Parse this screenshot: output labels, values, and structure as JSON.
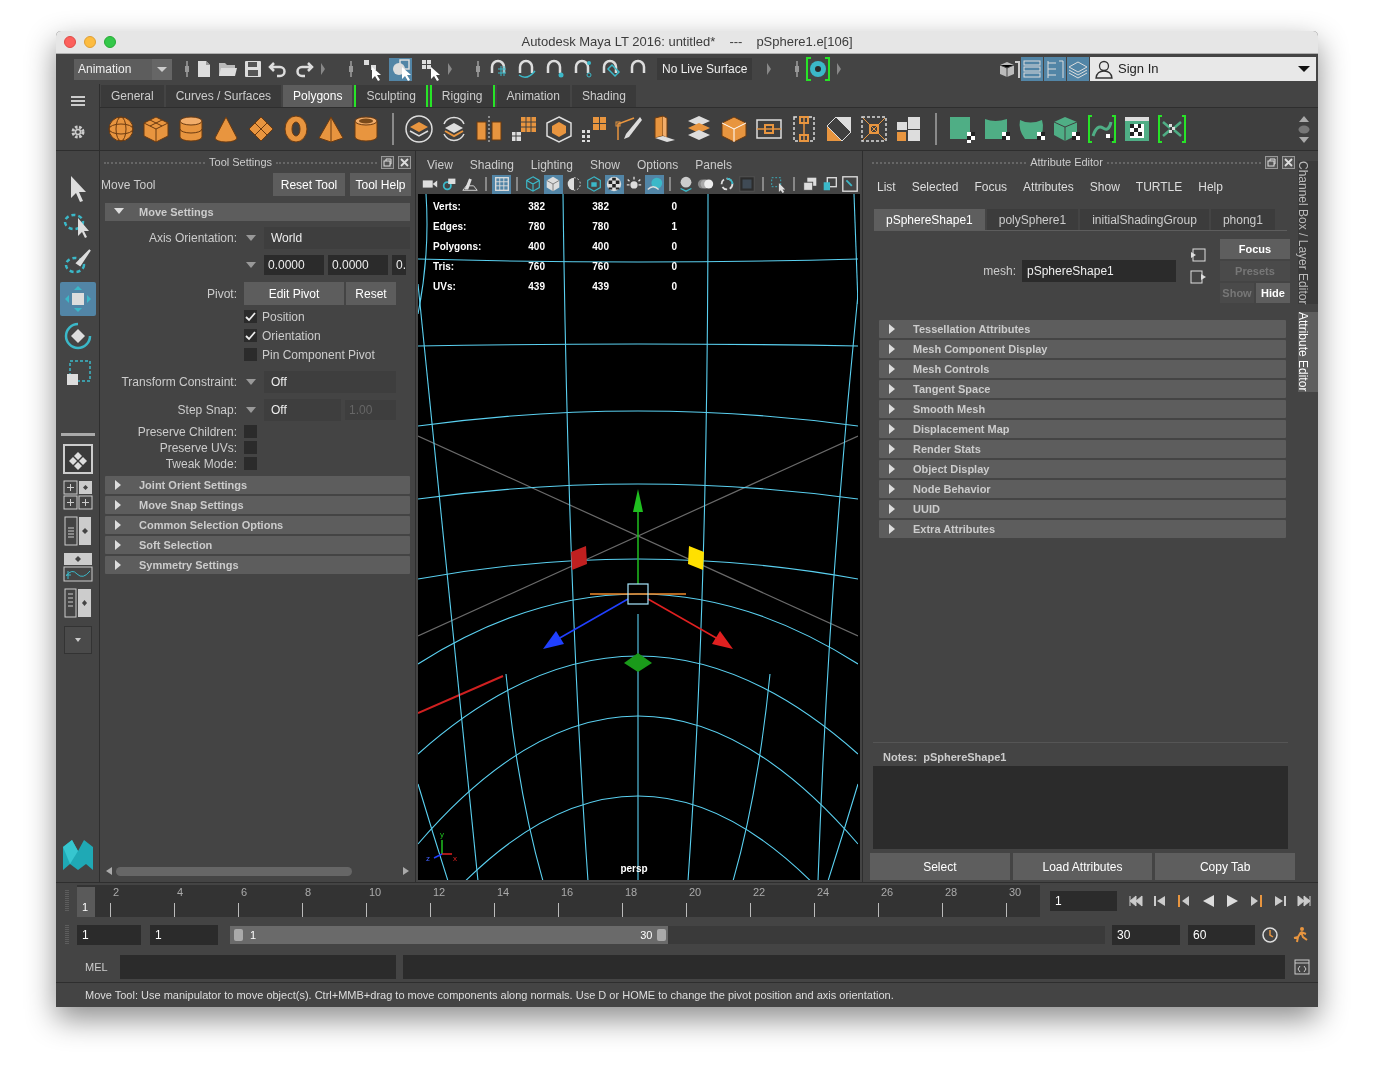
{
  "window": {
    "title": "Autodesk Maya LT 2016: untitled*",
    "separator": "---",
    "selection": "pSphere1.e[106]"
  },
  "status_line": {
    "menu_set": "Animation",
    "select_modes": [
      {
        "on": false
      },
      {
        "on": true
      },
      {
        "on": false
      }
    ],
    "live_surface": "No Live Surface",
    "panel_toggles": [
      {
        "on": true
      },
      {
        "on": true
      },
      {
        "on": true
      }
    ],
    "sign_in": "Sign In"
  },
  "shelf_tabs": [
    {
      "label": "General",
      "selected": false,
      "bracketed": false
    },
    {
      "label": "Curves / Surfaces",
      "selected": false,
      "bracketed": false
    },
    {
      "label": "Polygons",
      "selected": true,
      "bracketed": false
    },
    {
      "label": "Sculpting",
      "selected": false,
      "bracketed": true
    },
    {
      "label": "Rigging",
      "selected": false,
      "bracketed": true
    },
    {
      "label": "Animation",
      "selected": false,
      "bracketed": false
    },
    {
      "label": "Shading",
      "selected": false,
      "bracketed": false
    }
  ],
  "toolbox": {
    "tools": [
      {
        "selected": false
      },
      {
        "selected": false
      },
      {
        "selected": false
      },
      {
        "selected": true
      },
      {
        "selected": false
      },
      {
        "selected": false
      }
    ]
  },
  "tool_settings": {
    "title": "Tool Settings",
    "tool": "Move Tool",
    "buttons": [
      "Reset Tool",
      "Tool Help"
    ],
    "move_settings": {
      "label": "Move Settings",
      "expanded": true,
      "axis_orientation": {
        "label": "Axis Orientation:",
        "value": "World"
      },
      "custom_axis": [
        "0.0000",
        "0.0000",
        "0."
      ],
      "pivot": {
        "label": "Pivot:",
        "buttons": [
          "Edit Pivot",
          "Reset"
        ]
      },
      "pivot_options": [
        {
          "label": "Position",
          "checked": true
        },
        {
          "label": "Orientation",
          "checked": true
        },
        {
          "label": "Pin Component Pivot",
          "checked": false
        }
      ],
      "transform_constraint": {
        "label": "Transform Constraint:",
        "value": "Off"
      },
      "step_snap": {
        "label": "Step Snap:",
        "value": "Off",
        "amount": "1.00"
      },
      "toggles": [
        {
          "label": "Preserve Children:",
          "checked": false
        },
        {
          "label": "Preserve UVs:",
          "checked": false
        },
        {
          "label": "Tweak Mode:",
          "checked": false
        }
      ]
    },
    "sections": [
      {
        "label": "Joint Orient Settings",
        "expanded": false
      },
      {
        "label": "Move Snap Settings",
        "expanded": false
      },
      {
        "label": "Common Selection Options",
        "expanded": false
      },
      {
        "label": "Soft Selection",
        "expanded": false
      },
      {
        "label": "Symmetry Settings",
        "expanded": false
      }
    ]
  },
  "viewport": {
    "menus": [
      "View",
      "Shading",
      "Lighting",
      "Show",
      "Options",
      "Panels"
    ],
    "toolbar": [
      {
        "on": false
      },
      {
        "on": false
      },
      {
        "on": false
      },
      {
        "on": true
      },
      {
        "on": false
      },
      {
        "on": true
      },
      {
        "on": false
      },
      {
        "on": false
      },
      {
        "on": true
      },
      {
        "on": false
      },
      {
        "on": true
      },
      {
        "on": false
      },
      {
        "on": false
      },
      {
        "on": false
      },
      {
        "on": false
      },
      {
        "on": false
      },
      {
        "on": false
      },
      {
        "on": false
      },
      {
        "on": false
      }
    ],
    "hud": [
      {
        "label": "Verts:",
        "values": [
          "382",
          "382",
          "0"
        ]
      },
      {
        "label": "Edges:",
        "values": [
          "780",
          "780",
          "1"
        ]
      },
      {
        "label": "Polygons:",
        "values": [
          "400",
          "400",
          "0"
        ]
      },
      {
        "label": "Tris:",
        "values": [
          "760",
          "760",
          "0"
        ]
      },
      {
        "label": "UVs:",
        "values": [
          "439",
          "439",
          "0"
        ]
      }
    ],
    "axes": [
      "y",
      "z",
      "x"
    ],
    "camera": "persp"
  },
  "attribute_editor": {
    "title": "Attribute Editor",
    "menus": [
      "List",
      "Selected",
      "Focus",
      "Attributes",
      "Show",
      "TURTLE",
      "Help"
    ],
    "tabs": [
      {
        "label": "pSphereShape1",
        "selected": true
      },
      {
        "label": "polySphere1",
        "selected": false
      },
      {
        "label": "initialShadingGroup",
        "selected": false
      },
      {
        "label": "phong1",
        "selected": false
      }
    ],
    "mesh": {
      "label": "mesh:",
      "value": "pSphereShape1"
    },
    "buttons": [
      {
        "label": "Focus",
        "disabled": false
      },
      {
        "label": "Presets",
        "disabled": true
      },
      {
        "label": "Show",
        "disabled": true
      },
      {
        "label": "Hide",
        "disabled": false
      }
    ],
    "sections": [
      {
        "label": "Tessellation Attributes",
        "expanded": false
      },
      {
        "label": "Mesh Component Display",
        "expanded": false
      },
      {
        "label": "Mesh Controls",
        "expanded": false
      },
      {
        "label": "Tangent Space",
        "expanded": false
      },
      {
        "label": "Smooth Mesh",
        "expanded": false
      },
      {
        "label": "Displacement Map",
        "expanded": false
      },
      {
        "label": "Render Stats",
        "expanded": false
      },
      {
        "label": "Object Display",
        "expanded": false
      },
      {
        "label": "Node Behavior",
        "expanded": false
      },
      {
        "label": "UUID",
        "expanded": false
      },
      {
        "label": "Extra Attributes",
        "expanded": false
      }
    ],
    "notes": {
      "label": "Notes:",
      "node": "pSphereShape1"
    },
    "bottom_buttons": [
      "Select",
      "Load Attributes",
      "Copy Tab"
    ]
  },
  "side_tabs": [
    {
      "label": "Channel Box / Layer Editor",
      "selected": false
    },
    {
      "label": "Attribute Editor",
      "selected": true
    }
  ],
  "time_slider": {
    "current_frame": "1",
    "level": 0,
    "labels": [
      "2",
      "4",
      "6",
      "8",
      "10",
      "12",
      "14",
      "16",
      "18",
      "20",
      "22",
      "24",
      "26",
      "28",
      "30"
    ],
    "frame_field": "1"
  },
  "range_slider": {
    "animation_start": "1",
    "playback_start": "1",
    "range_start": "1",
    "range_end": "30",
    "level": 0.5,
    "playback_end": "30",
    "animation_end": "60"
  },
  "command_line": {
    "language": "MEL"
  },
  "help_line": "Move Tool: Use manipulator to move object(s). Ctrl+MMB+drag to move components along normals. Use D or HOME to change the pivot position and axis orientation."
}
